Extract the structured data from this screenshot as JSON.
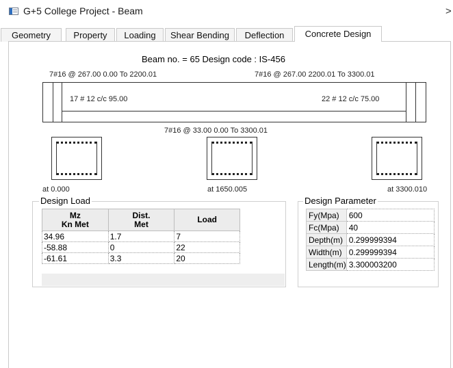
{
  "window": {
    "title": "G+5 College Project - Beam",
    "close_glyph": ">"
  },
  "tabs": [
    {
      "label": "Geometry"
    },
    {
      "label": "Property"
    },
    {
      "label": "Loading"
    },
    {
      "label": "Shear Bending"
    },
    {
      "label": "Deflection"
    },
    {
      "label": "Concrete Design",
      "active": true
    }
  ],
  "design": {
    "header": "Beam no. = 65  Design code :  IS-456",
    "top_left_rebar": "7#16 @ 267.00 0.00 To 2200.01",
    "top_right_rebar": "7#16 @ 267.00 2200.01 To 3300.01",
    "stirrups_left": "17 # 12 c/c 95.00",
    "stirrups_right": "22 # 12 c/c 75.00",
    "bottom_rebar": "7#16 @ 33.00 0.00 To 3300.01",
    "sections": [
      {
        "label": "at 0.000"
      },
      {
        "label": "at 1650.005"
      },
      {
        "label": "at 3300.010"
      }
    ]
  },
  "design_load": {
    "title": "Design Load",
    "columns": [
      "Mz\nKn Met",
      "Dist.\nMet",
      "Load"
    ],
    "rows": [
      [
        "34.96",
        "1.7",
        "7"
      ],
      [
        "-58.88",
        "0",
        "22"
      ],
      [
        "-61.61",
        "3.3",
        "20"
      ]
    ]
  },
  "design_parameter": {
    "title": "Design Parameter",
    "rows": [
      [
        "Fy(Mpa)",
        "600"
      ],
      [
        "Fc(Mpa)",
        "40"
      ],
      [
        "Depth(m)",
        "0.299999394"
      ],
      [
        "Width(m)",
        "0.299999394"
      ],
      [
        "Length(m)",
        "3.300003200"
      ]
    ]
  }
}
